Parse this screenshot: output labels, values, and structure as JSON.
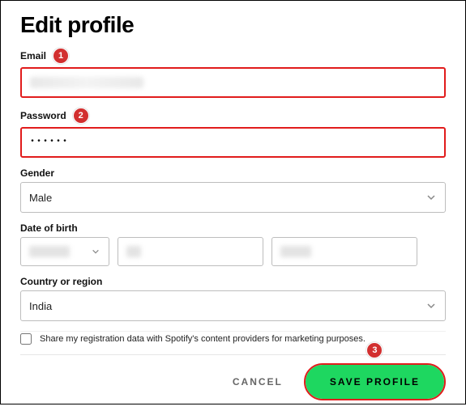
{
  "page": {
    "title": "Edit profile"
  },
  "annotations": {
    "email_badge": "1",
    "password_badge": "2",
    "save_badge": "3"
  },
  "fields": {
    "email": {
      "label": "Email",
      "value": ""
    },
    "password": {
      "label": "Password",
      "value": "••••••"
    },
    "gender": {
      "label": "Gender",
      "value": "Male"
    },
    "dob": {
      "label": "Date of birth",
      "month": "",
      "day": "",
      "year": ""
    },
    "country": {
      "label": "Country or region",
      "value": "India"
    },
    "marketing": {
      "label": "Share my registration data with Spotify's content providers for marketing purposes.",
      "checked": false
    }
  },
  "actions": {
    "cancel": "CANCEL",
    "save": "SAVE PROFILE"
  },
  "colors": {
    "accent": "#1ed760",
    "highlight": "#e11c1c",
    "badge": "#d22f2f"
  }
}
